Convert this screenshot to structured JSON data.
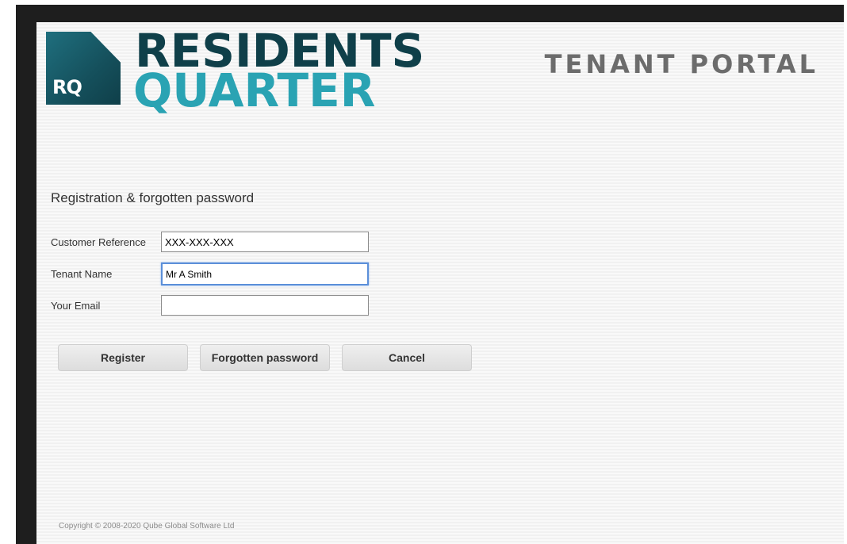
{
  "header": {
    "logo": {
      "mark_text": "RQ",
      "line1": "RESIDENTS",
      "line2": "QUARTER",
      "colors": {
        "dark": "#0f3f49",
        "teal": "#2aa3b3",
        "mark": "#1f6f7e"
      }
    },
    "portal_title": "TENANT PORTAL"
  },
  "form": {
    "heading": "Registration & forgotten password",
    "fields": [
      {
        "label": "Customer Reference",
        "value": "XXX-XXX-XXX",
        "placeholder": ""
      },
      {
        "label": "Tenant Name",
        "value": "Mr A Smith",
        "placeholder": "",
        "focused": true
      },
      {
        "label": "Your Email",
        "value": "",
        "placeholder": ""
      }
    ],
    "buttons": {
      "register": "Register",
      "forgotten": "Forgotten password",
      "cancel": "Cancel"
    }
  },
  "footer": {
    "copyright": "Copyright © 2008-2020 Qube Global Software Ltd"
  }
}
